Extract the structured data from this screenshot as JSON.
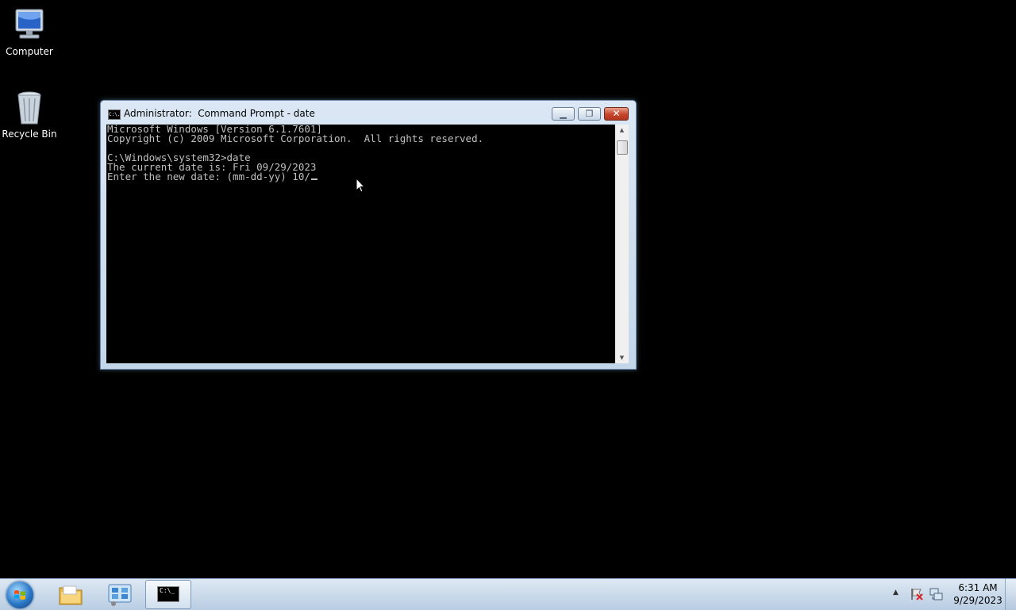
{
  "desktop": {
    "icons": [
      {
        "label": "Computer",
        "icon": "computer-icon"
      },
      {
        "label": "Recycle Bin",
        "icon": "recycle-bin-icon"
      }
    ]
  },
  "window": {
    "title": "Administrator:  Command Prompt - date",
    "icon": "cmd-icon",
    "icon_text": "C:\\.",
    "buttons": {
      "minimize": "minimize",
      "maximize": "maximize",
      "close": "close"
    },
    "console_lines": [
      "Microsoft Windows [Version 6.1.7601]",
      "Copyright (c) 2009 Microsoft Corporation.  All rights reserved.",
      "",
      "C:\\Windows\\system32>date",
      "The current date is: Fri 09/29/2023",
      "Enter the new date: (mm-dd-yy) 10/"
    ],
    "colors": {
      "console_bg": "#000000",
      "console_fg": "#c0c0c0"
    }
  },
  "taskbar": {
    "start": {
      "icon": "windows-start-orb-icon"
    },
    "pinned": [
      {
        "name": "explorer",
        "icon": "folder-icon"
      },
      {
        "name": "control-panel",
        "icon": "control-panel-icon"
      },
      {
        "name": "command-prompt",
        "icon": "cmd-icon",
        "active": true,
        "icon_text": "C:\\_"
      }
    ],
    "tray": {
      "icons": [
        "show-hidden-icons-chevron-icon",
        "action-center-flag-icon",
        "network-icon"
      ],
      "time": "6:31 AM",
      "date": "9/29/2023"
    }
  }
}
